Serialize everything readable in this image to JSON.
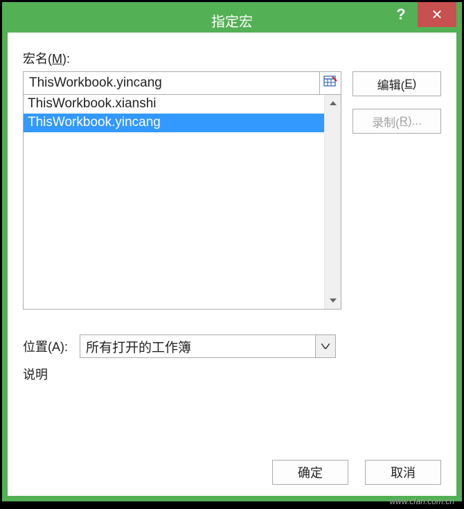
{
  "titlebar": {
    "title": "指定宏",
    "help": "?",
    "close": "✕"
  },
  "macro_name": {
    "label_prefix": "宏名(",
    "label_key": "M",
    "label_suffix": "):",
    "value": "ThisWorkbook.yincang"
  },
  "macro_list": [
    {
      "label": "ThisWorkbook.xianshi",
      "selected": false
    },
    {
      "label": "ThisWorkbook.yincang",
      "selected": true
    }
  ],
  "buttons": {
    "edit_prefix": "编辑(",
    "edit_key": "E",
    "edit_suffix": ")",
    "record_prefix": "录制(",
    "record_key": "R",
    "record_suffix": ")..."
  },
  "location": {
    "label_prefix": "位置(",
    "label_key": "A",
    "label_suffix": "):",
    "value": "所有打开的工作簿"
  },
  "description": {
    "label": "说明"
  },
  "footer": {
    "ok": "确定",
    "cancel": "取消"
  },
  "watermark": "www.cfan.com.cn"
}
